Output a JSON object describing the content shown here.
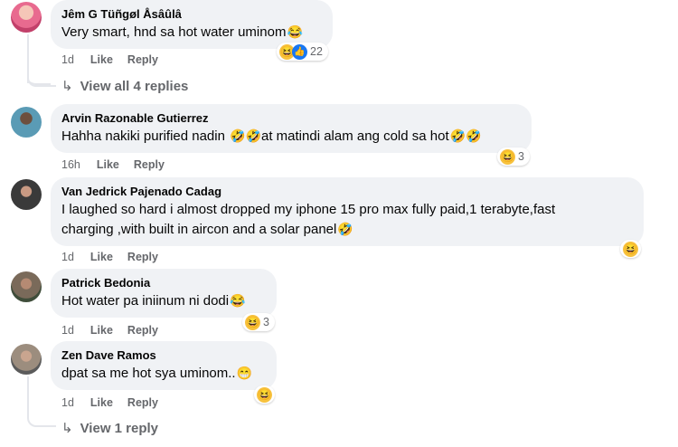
{
  "comments": [
    {
      "author": "Jêm G Tüñgøl Åsâûlâ",
      "text": "Very smart, hnd sa hot water uminom",
      "text_emoji": "😂",
      "time": "1d",
      "like": "Like",
      "reply": "Reply",
      "reaction_count": "22"
    },
    {
      "author": "Arvin Razonable Gutierrez",
      "text1": "Hahha nakiki purified nadin ",
      "emoji1": "🤣🤣",
      "text2": "at matindi alam ang cold sa hot",
      "emoji2": "🤣🤣",
      "time": "16h",
      "like": "Like",
      "reply": "Reply",
      "reaction_count": "3"
    },
    {
      "author": "Van Jedrick Pajenado Cadag",
      "line1": "I laughed so hard i almost dropped my iphone 15 pro max fully paid,1 terabyte,fast",
      "line2": "charging ,with built in aircon and a solar panel",
      "emoji": "🤣",
      "time": "1d",
      "like": "Like",
      "reply": "Reply"
    },
    {
      "author": "Patrick Bedonia",
      "text": "Hot water pa iniinum ni dodi",
      "emoji": "😂",
      "time": "1d",
      "like": "Like",
      "reply": "Reply",
      "reaction_count": "3"
    },
    {
      "author": "Zen Dave Ramos",
      "text": "dpat sa me hot sya uminom..",
      "emoji": "😁",
      "time": "1d",
      "like": "Like",
      "reply": "Reply"
    }
  ],
  "view_all_replies": "View all 4 replies",
  "view_one_reply": "View 1 reply",
  "icons": {
    "haha": "haha-icon",
    "like": "like-icon",
    "reply_arrow": "reply-arrow-icon"
  },
  "colors": {
    "bubble": "#f0f2f5",
    "meta": "#65676b",
    "like_blue": "#1877f2",
    "haha_yellow": "#f7c23e"
  }
}
